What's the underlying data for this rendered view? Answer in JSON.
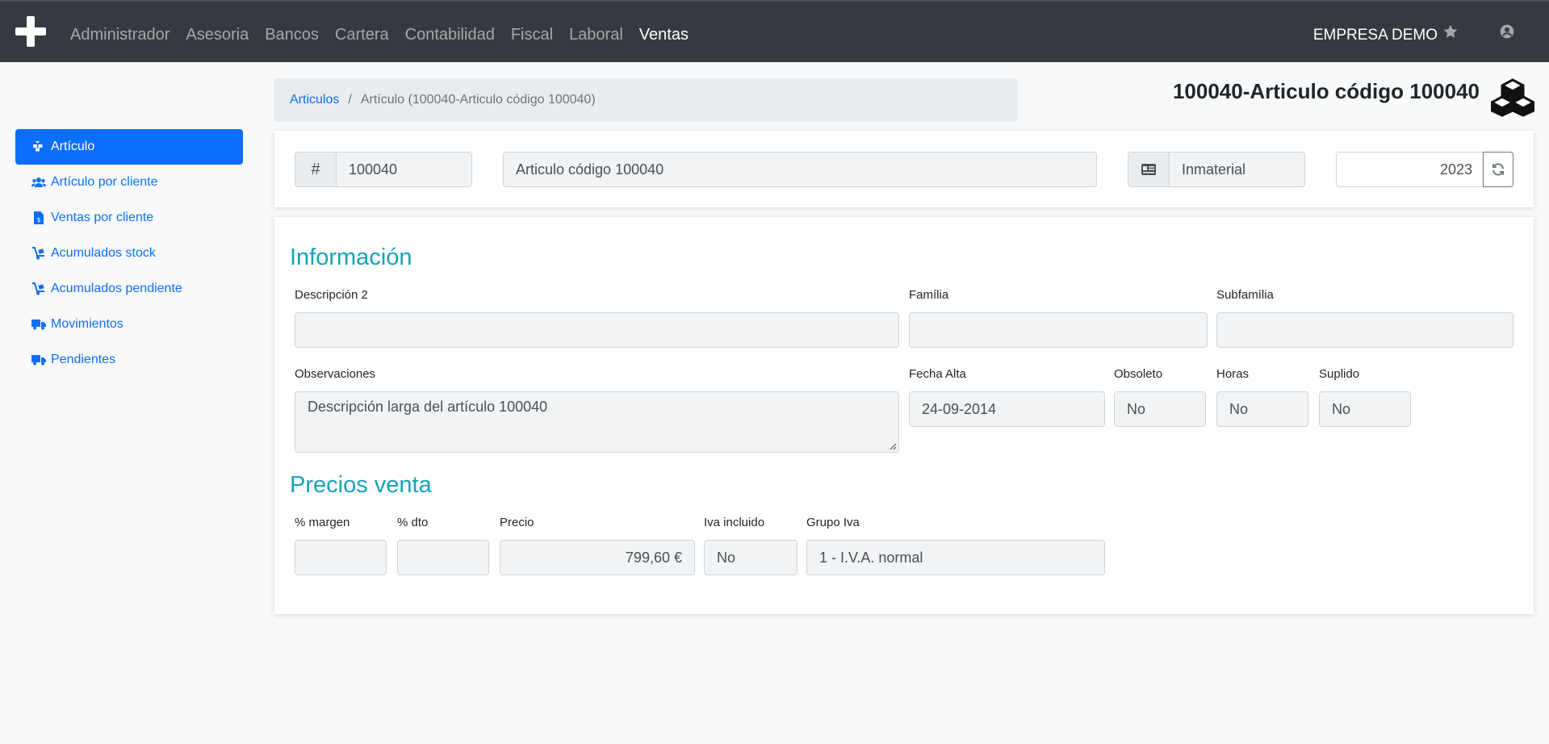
{
  "nav": {
    "items": [
      {
        "label": "Administrador",
        "active": false
      },
      {
        "label": "Asesoria",
        "active": false
      },
      {
        "label": "Bancos",
        "active": false
      },
      {
        "label": "Cartera",
        "active": false
      },
      {
        "label": "Contabilidad",
        "active": false
      },
      {
        "label": "Fiscal",
        "active": false
      },
      {
        "label": "Laboral",
        "active": false
      },
      {
        "label": "Ventas",
        "active": true
      }
    ],
    "company": "EMPRESA DEMO"
  },
  "sidebar": {
    "items": [
      {
        "label": "Artículo",
        "icon": "cubes-icon",
        "active": true
      },
      {
        "label": "Artículo por cliente",
        "icon": "users-icon",
        "active": false
      },
      {
        "label": "Ventas por cliente",
        "icon": "invoice-icon",
        "active": false
      },
      {
        "label": "Acumulados stock",
        "icon": "dolly-icon",
        "active": false
      },
      {
        "label": "Acumulados pendiente",
        "icon": "dolly-icon",
        "active": false
      },
      {
        "label": "Movimientos",
        "icon": "truck-icon",
        "active": false
      },
      {
        "label": "Pendientes",
        "icon": "truck-icon",
        "active": false
      }
    ]
  },
  "breadcrumb": {
    "root": "Articulos",
    "separator": "/",
    "current": "Artículo (100040-Articulo código 100040)"
  },
  "page_title": "100040-Articulo código 100040",
  "header": {
    "code_prefix": "#",
    "code": "100040",
    "name": "Articulo código 100040",
    "type": "Inmaterial",
    "year": "2023"
  },
  "info": {
    "title": "Información",
    "descripcion2": {
      "label": "Descripción 2",
      "value": ""
    },
    "familia": {
      "label": "Família",
      "value": ""
    },
    "subfamilia": {
      "label": "Subfamília",
      "value": ""
    },
    "observaciones": {
      "label": "Observaciones",
      "value": "Descripción larga del artículo 100040"
    },
    "fecha_alta": {
      "label": "Fecha Alta",
      "value": "24-09-2014"
    },
    "obsoleto": {
      "label": "Obsoleto",
      "value": "No"
    },
    "horas": {
      "label": "Horas",
      "value": "No"
    },
    "suplido": {
      "label": "Suplido",
      "value": "No"
    }
  },
  "precios": {
    "title": "Precios venta",
    "margen": {
      "label": "% margen",
      "value": ""
    },
    "dto": {
      "label": "% dto",
      "value": ""
    },
    "precio": {
      "label": "Precio",
      "value": "799,60 €"
    },
    "iva_incluido": {
      "label": "Iva incluido",
      "value": "No"
    },
    "grupo_iva": {
      "label": "Grupo Iva",
      "value": "1 - I.V.A. normal"
    }
  },
  "colors": {
    "navbar": "#343a40",
    "primary": "#0d6efd",
    "section": "#17a2b8"
  }
}
